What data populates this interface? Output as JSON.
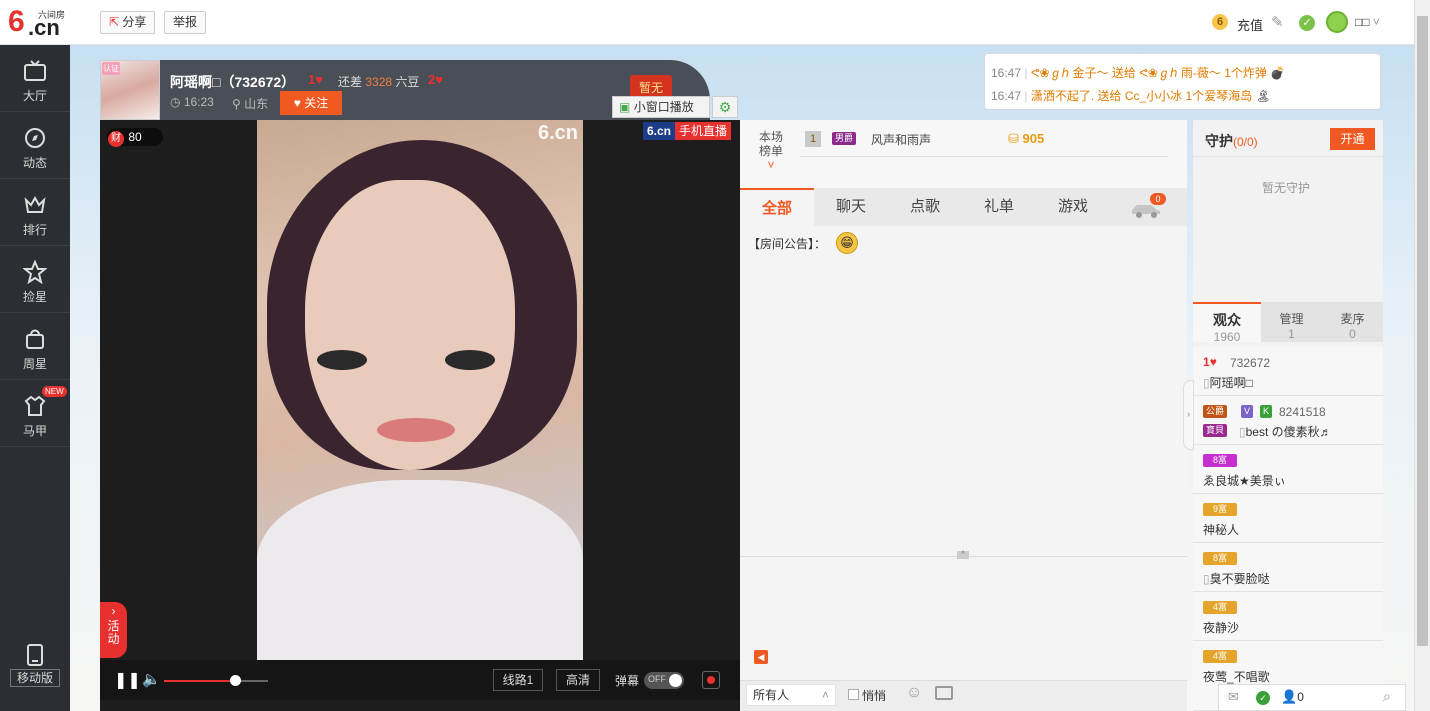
{
  "header": {
    "share_label": "分享",
    "report_label": "举报",
    "recharge_label": "充值",
    "user_name": "□□",
    "logo_small": "六间房",
    "logo_big": ".cn"
  },
  "sidebar": {
    "items": [
      {
        "label": "大厅",
        "icon": "tv-icon"
      },
      {
        "label": "动态",
        "icon": "compass-icon"
      },
      {
        "label": "排行",
        "icon": "crown-icon"
      },
      {
        "label": "捡星",
        "icon": "star-icon"
      },
      {
        "label": "周星",
        "icon": "bag-icon"
      },
      {
        "label": "马甲",
        "icon": "shirt-icon",
        "badge": "NEW"
      }
    ],
    "mobile_label": "移动版"
  },
  "host": {
    "name": "阿瑶啊□（732672）",
    "level_a": "1",
    "gap_prefix": "还差",
    "gap_value": "3328",
    "gap_suffix": "六豆",
    "level_b": "2",
    "time": "16:23",
    "location": "山东",
    "follow_label": "关注",
    "tag": "暂无",
    "mini_player_label": "小窗口播放",
    "cert_badge": "认证"
  },
  "video": {
    "wealth_icon": "财",
    "wealth_value": "80",
    "watermark": "6.cn",
    "mobile_live_brand": "6.cn",
    "mobile_live_label": "手机直播",
    "activity_label": "活动",
    "line_label": "线路1",
    "quality_label": "高清",
    "danmaku_label": "弹幕",
    "danmaku_state": "OFF",
    "volume_level": 0.68
  },
  "gifts": [
    {
      "time": "16:47",
      "text": "ᕙ❀ℊℎ 金子～ 送给 ᕙ❀ℊℎ 雨-薇～ 1个炸弹"
    },
    {
      "time": "16:47",
      "text": "潇洒不起了. 送给 Cc_小小冰 1个爱琴海岛"
    }
  ],
  "rank": {
    "label_1": "本场",
    "label_2": "榜单",
    "position": "1",
    "badge": "男爵",
    "name": "风声和雨声",
    "score": "905"
  },
  "chat": {
    "tabs": [
      "全部",
      "聊天",
      "点歌",
      "礼单",
      "游戏"
    ],
    "active_tab": 0,
    "car_count": "0",
    "announcement": "【房间公告】：",
    "recipient": "所有人",
    "whisper_label": "悄悄"
  },
  "guard": {
    "title": "守护",
    "count": "(0/0)",
    "open_label": "开通",
    "empty_text": "暂无守护"
  },
  "audience_tabs": [
    {
      "label": "观众",
      "count": "1960"
    },
    {
      "label": "管理",
      "count": "1"
    },
    {
      "label": "麦序",
      "count": "0"
    }
  ],
  "audience": [
    {
      "line1": "732672",
      "name": "阿瑶啊□",
      "badges": [
        "1"
      ]
    },
    {
      "line1": "8241518",
      "name": "best の傻素秋♬",
      "badges": [
        "公爵",
        "V",
        "K",
        "寶貝"
      ]
    },
    {
      "line1": "",
      "name": "ゑ良城★美景ぃ",
      "badges": [
        "8富"
      ]
    },
    {
      "line1": "",
      "name": "神秘人",
      "badges": [
        "9富"
      ]
    },
    {
      "line1": "",
      "name": "臭不要脸哒",
      "badges": [
        "8富"
      ]
    },
    {
      "line1": "",
      "name": "夜静沙",
      "badges": [
        "4富"
      ]
    },
    {
      "line1": "",
      "name": "夜莺_不唱歌",
      "badges": [
        "4富"
      ]
    }
  ],
  "bottom_bar": {
    "count": "0"
  },
  "colors": {
    "accent": "#f05a22",
    "sidebar": "#2b2f34",
    "gift_text": "#e07b00"
  }
}
